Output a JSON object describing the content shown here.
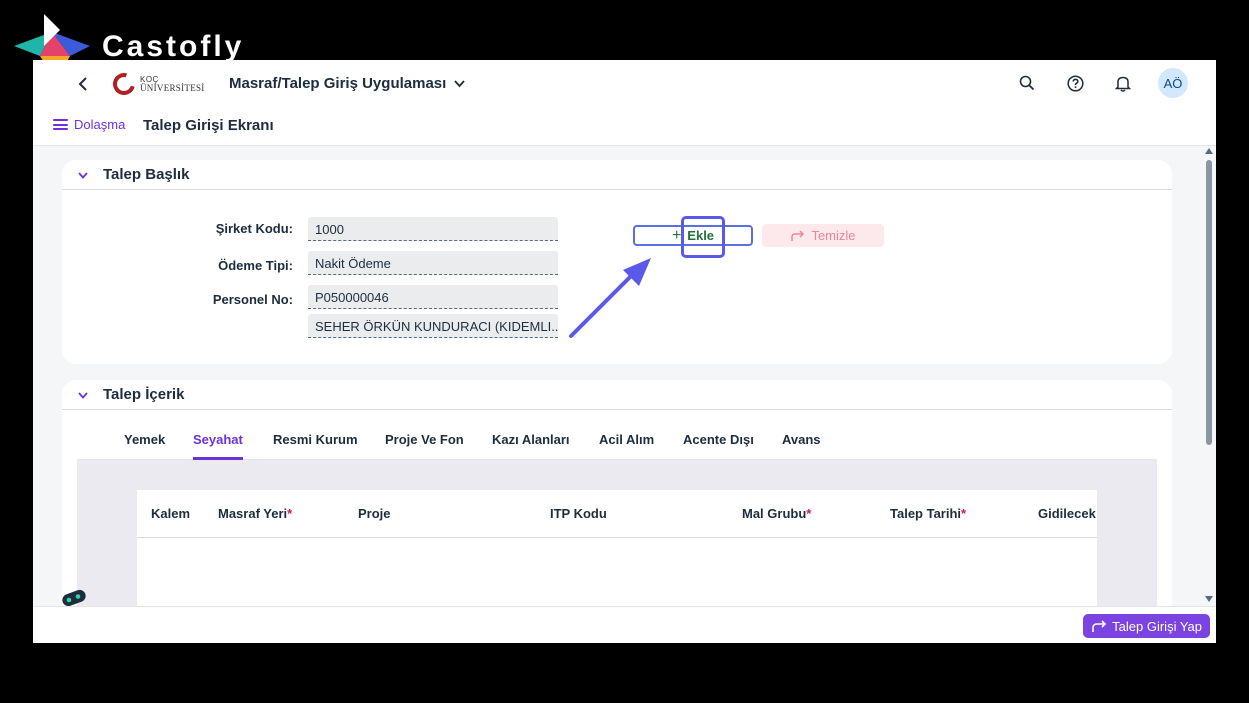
{
  "watermark": {
    "brand": "Castofly",
    "logo_icon": "castofly-logo-icon"
  },
  "shellbar": {
    "back_icon": "chevron-left-icon",
    "logo": {
      "line1": "KOÇ",
      "line2": "ÜNİVERSİTESİ"
    },
    "app_title": "Masraf/Talep Giriş Uygulaması",
    "title_chevron": "chevron-down-icon",
    "icons": [
      "search-icon",
      "help-icon",
      "bell-icon"
    ],
    "avatar_initials": "AÖ"
  },
  "subheader": {
    "nav_label": "Dolaşma",
    "page_title": "Talep Girişi Ekranı"
  },
  "header_panel": {
    "title": "Talep Başlık",
    "fields": {
      "sirket_kodu": {
        "label": "Şirket Kodu:",
        "value": "1000"
      },
      "odeme_tipi": {
        "label": "Ödeme Tipi:",
        "value": "Nakit Ödeme"
      },
      "personel_no": {
        "label": "Personel No:",
        "value": "P050000046",
        "name_value": "SEHER ÖRKÜN KUNDURACI (KIDEMLI..."
      }
    },
    "add_button": {
      "label": "Ekle",
      "icon": "plus-icon"
    },
    "clear_button": {
      "label": "Temizle",
      "icon": "redo-arrow-icon"
    }
  },
  "content_panel": {
    "title": "Talep İçerik",
    "tabs": [
      "Yemek",
      "Seyahat",
      "Resmi Kurum",
      "Proje Ve Fon",
      "Kazı Alanları",
      "Acil Alım",
      "Acente Dışı",
      "Avans"
    ],
    "active_tab": "Seyahat",
    "columns": [
      {
        "label": "Kalem",
        "required": ""
      },
      {
        "label": "Masraf Yeri",
        "required": "*"
      },
      {
        "label": "Proje",
        "required": ""
      },
      {
        "label": "ITP Kodu",
        "required": ""
      },
      {
        "label": "Mal Grubu",
        "required": "*"
      },
      {
        "label": "Talep Tarihi",
        "required": "*"
      },
      {
        "label": "Gidilecek Y",
        "required": ""
      }
    ]
  },
  "footer": {
    "submit_label": "Talep Girişi Yap",
    "submit_icon": "share-arrow-icon",
    "bot_icon": "chatbot-icon"
  },
  "colors": {
    "accent": "#6d32d8",
    "highlight": "#5b59e8",
    "success_text": "#256f3a",
    "required": "#c0224e"
  }
}
